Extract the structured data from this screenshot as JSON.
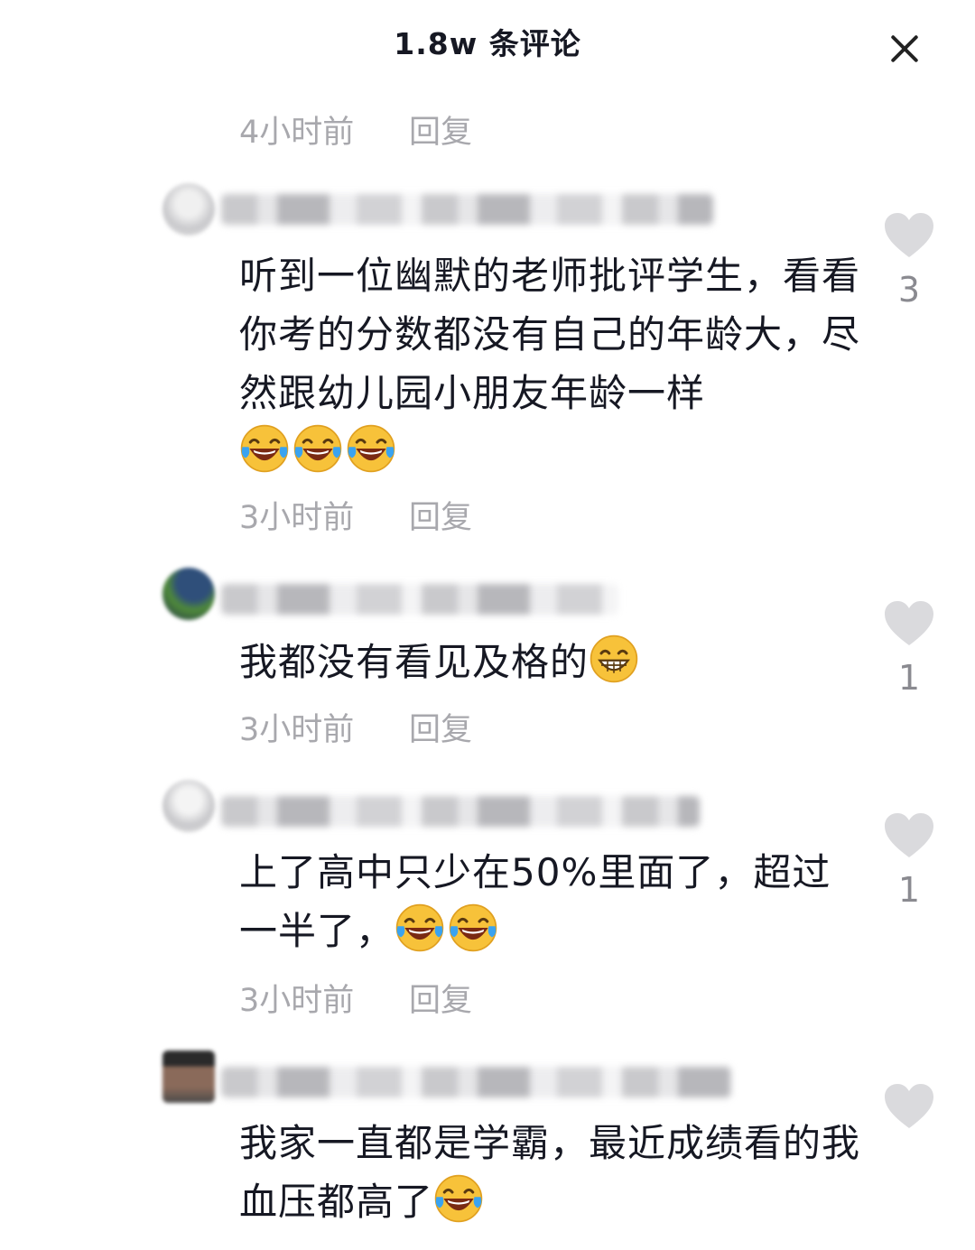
{
  "header": {
    "title": "1.8w 条评论",
    "close_icon": "close-icon"
  },
  "top_meta": {
    "time": "4小时前",
    "reply": "回复"
  },
  "comments": [
    {
      "text": "听到一位幽默的老师批评学生，看看你考的分数都没有自己的年龄大，尽然跟幼儿园小朋友年龄一样",
      "emojis": [
        "laugh-cry-emoji",
        "laugh-cry-emoji",
        "laugh-cry-emoji"
      ],
      "likes": "3",
      "time": "3小时前",
      "reply": "回复"
    },
    {
      "text": "我都没有看见及格的",
      "emojis": [
        "grin-emoji"
      ],
      "likes": "1",
      "time": "3小时前",
      "reply": "回复"
    },
    {
      "text": "上了高中只少在50%里面了，超过一半了，",
      "emojis": [
        "laugh-cry-emoji",
        "laugh-cry-emoji"
      ],
      "likes": "1",
      "time": "3小时前",
      "reply": "回复"
    },
    {
      "text": "我家一直都是学霸，最近成绩看的我血压都高了",
      "emojis": [
        "laugh-cry-emoji"
      ],
      "likes": "",
      "time": "",
      "reply": ""
    }
  ],
  "colors": {
    "text": "#161823",
    "meta": "#a8a8ad",
    "heart": "#d9d9dc",
    "emoji_face": "#f7c23a"
  }
}
